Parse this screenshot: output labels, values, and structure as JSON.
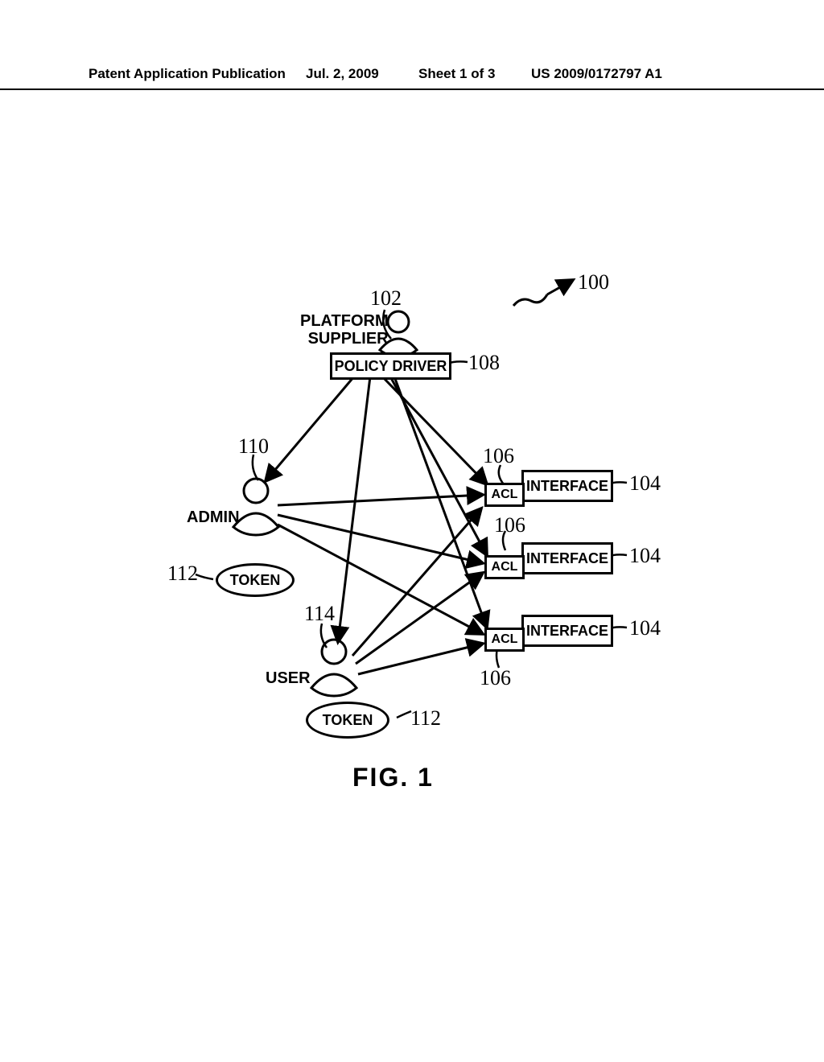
{
  "header": {
    "left": "Patent Application Publication",
    "date": "Jul. 2, 2009",
    "sheet": "Sheet 1 of 3",
    "pubno": "US 2009/0172797 A1"
  },
  "figure_caption": "FIG. 1",
  "nodes": {
    "platform_supplier": "PLATFORM\nSUPPLIER",
    "policy_driver": "POLICY DRIVER",
    "admin": "ADMIN",
    "user": "USER",
    "token": "TOKEN",
    "acl": "ACL",
    "interface": "INTERFACE"
  },
  "refs": {
    "r100": "100",
    "r102": "102",
    "r104": "104",
    "r106": "106",
    "r108": "108",
    "r110": "110",
    "r112": "112",
    "r114": "114"
  }
}
